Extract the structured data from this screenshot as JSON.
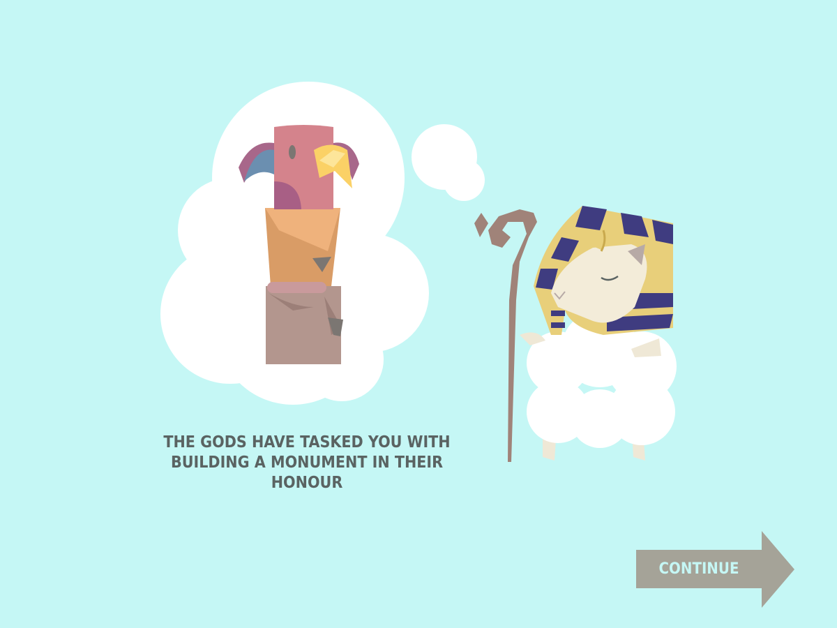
{
  "story": {
    "text": "THE GODS HAVE TASKED YOU WITH BUILDING A MONUMENT IN THEIR HONOUR"
  },
  "continue_button": {
    "label": "CONTINUE",
    "icon": "arrow-right-icon"
  },
  "colors": {
    "background": "#c5f7f5",
    "text": "#5a6362",
    "button": "#a5a398",
    "button_text": "#c5f7f5"
  }
}
